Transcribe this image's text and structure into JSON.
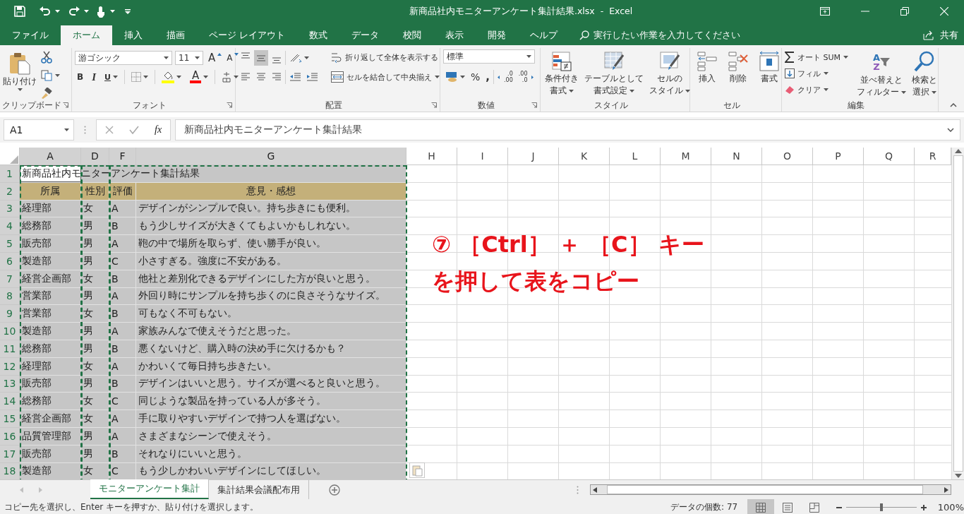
{
  "window": {
    "title": "新商品社内モニターアンケート集計結果.xlsx  -  Excel"
  },
  "ribbon_tabs": [
    {
      "label": "ファイル",
      "selected": false
    },
    {
      "label": "ホーム",
      "selected": true
    },
    {
      "label": "挿入",
      "selected": false
    },
    {
      "label": "描画",
      "selected": false
    },
    {
      "label": "ページ レイアウト",
      "selected": false
    },
    {
      "label": "数式",
      "selected": false
    },
    {
      "label": "データ",
      "selected": false
    },
    {
      "label": "校閲",
      "selected": false
    },
    {
      "label": "表示",
      "selected": false
    },
    {
      "label": "開発",
      "selected": false
    },
    {
      "label": "ヘルプ",
      "selected": false
    }
  ],
  "tell_me": {
    "placeholder": "実行したい作業を入力してください"
  },
  "share": "共有",
  "ribbon": {
    "clipboard": {
      "label": "クリップボード",
      "paste": "貼り付け"
    },
    "font": {
      "label": "フォント",
      "font_name": "游ゴシック",
      "font_size": "11",
      "grow": "A",
      "shrink": "A",
      "bold": "B",
      "italic": "I",
      "underline": "U",
      "font_color": "A"
    },
    "alignment": {
      "label": "配置",
      "vertical": [
        {
          "selected": false
        },
        {
          "selected": true
        },
        {
          "selected": false
        }
      ],
      "wrap_text": "折り返して全体を表示する",
      "merge_center": "セルを結合して中央揃え"
    },
    "number": {
      "label": "数値",
      "format": "標準",
      "percent": "%",
      "comma": ",",
      "increase_decimal": [
        ".0",
        ".00"
      ],
      "decrease_decimal": [
        ".00",
        ".0"
      ]
    },
    "styles": {
      "label": "スタイル",
      "buttons": [
        [
          "条件付き",
          "書式"
        ],
        [
          "テーブルとして",
          "書式設定"
        ],
        [
          "セルの",
          "スタイル"
        ]
      ]
    },
    "cells": {
      "label": "セル",
      "buttons": [
        "挿入",
        "削除",
        "書式"
      ]
    },
    "editing": {
      "label": "編集",
      "autosum": "オート SUM",
      "fill": "フィル",
      "clear": "クリア",
      "sort_letters": [
        "A",
        "Z"
      ],
      "sort_filter": [
        "並べ替えと",
        "フィルター"
      ],
      "find_select": [
        "検索と",
        "選択"
      ]
    }
  },
  "formula_bar": {
    "name_box": "A1",
    "fx": "fx",
    "formula": "新商品社内モニターアンケート集計結果"
  },
  "sheet": {
    "columns": [
      {
        "label": "A",
        "selected": true
      },
      {
        "label": "D",
        "selected": true
      },
      {
        "label": "F",
        "selected": true
      },
      {
        "label": "G",
        "selected": true
      },
      {
        "label": "H",
        "selected": false
      },
      {
        "label": "I",
        "selected": false
      },
      {
        "label": "J",
        "selected": false
      },
      {
        "label": "K",
        "selected": false
      },
      {
        "label": "L",
        "selected": false
      },
      {
        "label": "M",
        "selected": false
      },
      {
        "label": "N",
        "selected": false
      },
      {
        "label": "O",
        "selected": false
      },
      {
        "label": "P",
        "selected": false
      },
      {
        "label": "Q",
        "selected": false
      },
      {
        "label": "R",
        "selected": false
      }
    ],
    "rows": [
      {
        "number": "1",
        "selected": true,
        "kind": "title",
        "cells": [
          "新商品社内モニターアンケート集計結果"
        ]
      },
      {
        "number": "2",
        "selected": true,
        "kind": "header",
        "cells": [
          "所属",
          "性別",
          "評価",
          "意見・感想"
        ]
      },
      {
        "number": "3",
        "selected": true,
        "kind": "data",
        "cells": [
          "経理部",
          "女",
          "A",
          "デザインがシンプルで良い。持ち歩きにも便利。"
        ]
      },
      {
        "number": "4",
        "selected": true,
        "kind": "data",
        "cells": [
          "総務部",
          "男",
          "B",
          "もう少しサイズが大きくてもよいかもしれない。"
        ]
      },
      {
        "number": "5",
        "selected": true,
        "kind": "data",
        "cells": [
          "販売部",
          "男",
          "A",
          "鞄の中で場所を取らず、使い勝手が良い。"
        ]
      },
      {
        "number": "6",
        "selected": true,
        "kind": "data",
        "cells": [
          "製造部",
          "男",
          "C",
          "小さすぎる。強度に不安がある。"
        ]
      },
      {
        "number": "7",
        "selected": true,
        "kind": "data",
        "cells": [
          "経営企画部",
          "女",
          "B",
          "他社と差別化できるデザインにした方が良いと思う。"
        ]
      },
      {
        "number": "8",
        "selected": true,
        "kind": "data",
        "cells": [
          "営業部",
          "男",
          "A",
          "外回り時にサンプルを持ち歩くのに良さそうなサイズ。"
        ]
      },
      {
        "number": "9",
        "selected": true,
        "kind": "data",
        "cells": [
          "営業部",
          "女",
          "B",
          "可もなく不可もない。"
        ]
      },
      {
        "number": "10",
        "selected": true,
        "kind": "data",
        "cells": [
          "製造部",
          "男",
          "A",
          "家族みんなで使えそうだと思った。"
        ]
      },
      {
        "number": "11",
        "selected": true,
        "kind": "data",
        "cells": [
          "総務部",
          "男",
          "B",
          "悪くないけど、購入時の決め手に欠けるかも？"
        ]
      },
      {
        "number": "12",
        "selected": true,
        "kind": "data",
        "cells": [
          "経理部",
          "女",
          "A",
          "かわいくて毎日持ち歩きたい。"
        ]
      },
      {
        "number": "13",
        "selected": true,
        "kind": "data",
        "cells": [
          "販売部",
          "男",
          "B",
          "デザインはいいと思う。サイズが選べると良いと思う。"
        ]
      },
      {
        "number": "14",
        "selected": true,
        "kind": "data",
        "cells": [
          "総務部",
          "女",
          "C",
          "同じような製品を持っている人が多そう。"
        ]
      },
      {
        "number": "15",
        "selected": true,
        "kind": "data",
        "cells": [
          "経営企画部",
          "女",
          "A",
          "手に取りやすいデザインで持つ人を選ばない。"
        ]
      },
      {
        "number": "16",
        "selected": true,
        "kind": "data",
        "cells": [
          "品質管理部",
          "男",
          "A",
          "さまざまなシーンで使えそう。"
        ]
      },
      {
        "number": "17",
        "selected": true,
        "kind": "data",
        "cells": [
          "販売部",
          "男",
          "B",
          "それなりにいいと思う。"
        ]
      },
      {
        "number": "18",
        "selected": true,
        "kind": "data",
        "cells": [
          "製造部",
          "女",
          "C",
          "もう少しかわいいデザインにしてほしい。"
        ]
      }
    ]
  },
  "sheet_tabs": [
    {
      "label": "モニターアンケート集計",
      "selected": true
    },
    {
      "label": "集計結果会議配布用",
      "selected": false
    }
  ],
  "status_bar": {
    "message": "コピー先を選択し、Enter キーを押すか、貼り付けを選択します。",
    "count": "データの個数: 77",
    "views": [
      {
        "selected": true
      },
      {
        "selected": false
      },
      {
        "selected": false
      }
    ],
    "zoom": {
      "level": 0.5,
      "reading": "100%"
    }
  },
  "callout": {
    "lines": [
      "⑦ ［Ctrl］ ＋ ［C］ キー",
      "を押して表をコピー"
    ]
  }
}
